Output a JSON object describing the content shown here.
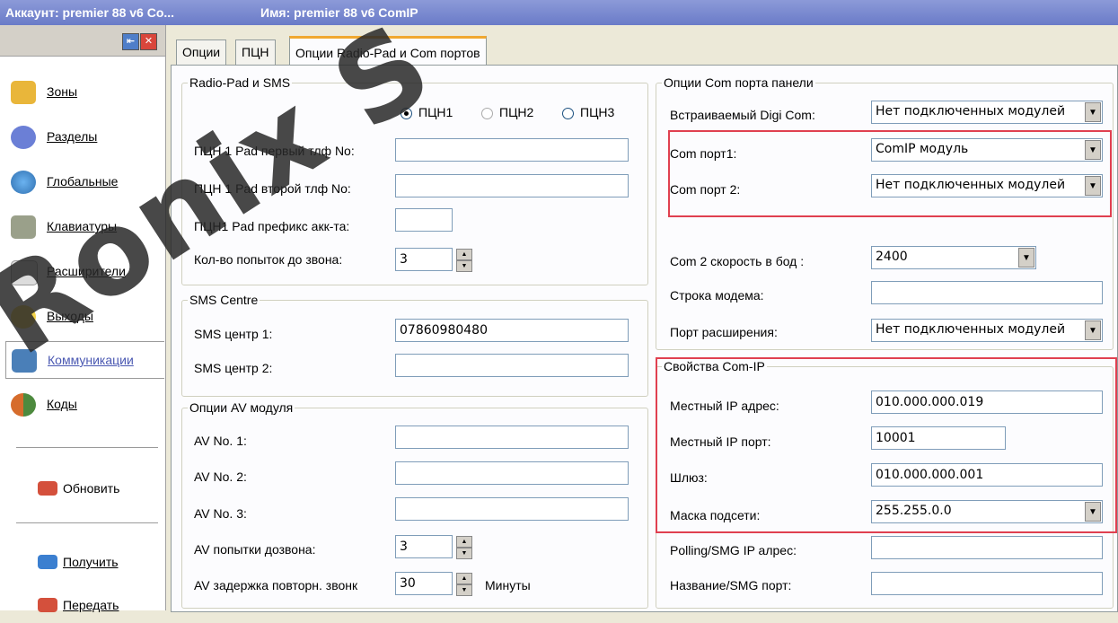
{
  "titlebar": {
    "account": "Аккаунт: premier 88 v6 Co...",
    "name": "Имя: premier 88 v6 ComIP"
  },
  "sidebar": {
    "items": [
      {
        "label": "Зоны",
        "icon": "lock-icon"
      },
      {
        "label": "Разделы",
        "icon": "partitions-icon"
      },
      {
        "label": "Глобальные",
        "icon": "globe-icon"
      },
      {
        "label": "Клавиатуры",
        "icon": "keypad-icon"
      },
      {
        "label": "Расширители",
        "icon": "expander-icon"
      },
      {
        "label": "Выходы",
        "icon": "bulb-icon"
      },
      {
        "label": "Коммуникации",
        "icon": "phone-icon"
      },
      {
        "label": "Коды",
        "icon": "users-icon"
      }
    ],
    "refresh": "Обновить",
    "receive": "Получить",
    "send": "Передать"
  },
  "tabs": [
    "Опции",
    "ПЦН",
    "Опции Radio-Pad и  Com портов"
  ],
  "left": {
    "radiopad": {
      "legend": "Radio-Pad и SMS",
      "radios": [
        "ПЦН1",
        "ПЦН2",
        "ПЦН3"
      ],
      "phone1_label": "ПЦН 1 Pad первый тлф No:",
      "phone2_label": "ПЦН 1 Pad второй тлф  No:",
      "prefix_label": "ПЦН1 Pad префикс акк-та:",
      "attempts_label": "Кол-во попыток до звона:",
      "attempts_value": "3"
    },
    "sms": {
      "legend": "SMS Centre",
      "c1_label": "SMS центр 1:",
      "c1_value": "07860980480",
      "c2_label": "SMS центр 2:"
    },
    "av": {
      "legend": "Опции AV модуля",
      "av1": "AV No. 1:",
      "av2": "AV No. 2:",
      "av3": "AV No. 3:",
      "attempts_label": "AV попытки дозвона:",
      "attempts_value": "3",
      "delay_label": "AV задержка повторн. звонк",
      "delay_value": "30",
      "minutes": "Минуты"
    }
  },
  "right": {
    "com": {
      "legend": "Опции Com порта панели",
      "digi_label": "Встраиваемый Digi Com:",
      "digi_value": "Нет подключенных модулей",
      "port1_label": "Com порт1:",
      "port1_value": "ComIP модуль",
      "port2_label": "Com порт 2:",
      "port2_value": "Нет подключенных модулей",
      "baud_label": "Com 2 скорость в бод :",
      "baud_value": "2400",
      "modem_label": "Строка модема:",
      "exp_label": "Порт расширения:",
      "exp_value": "Нет подключенных модулей"
    },
    "comip": {
      "legend": "Свойства Com-IP",
      "ip_label": "Местный IP адрес:",
      "ip_value": "010.000.000.019",
      "port_label": "Местный IP порт:",
      "port_value": "10001",
      "gw_label": "Шлюз:",
      "gw_value": "010.000.000.001",
      "mask_label": "Маска подсети:",
      "mask_value": "255.255.0.0",
      "poll_label": "Polling/SMG IP алрес:",
      "smgname_label": "Название/SMG порт:"
    }
  },
  "watermark": "Ronix S"
}
